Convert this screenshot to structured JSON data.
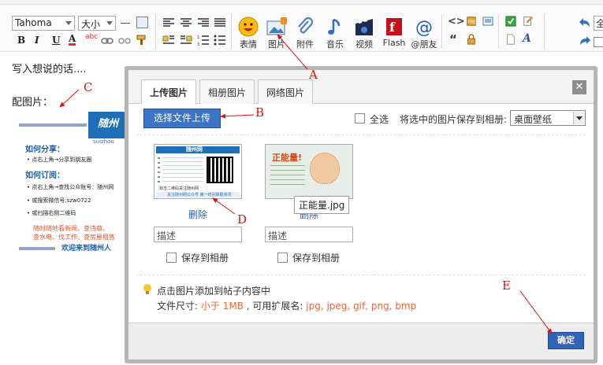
{
  "toolbar": {
    "font_name": "Tahoma",
    "font_size": "大小",
    "format_buttons": [
      "B",
      "I",
      "U",
      "A"
    ],
    "media_tools": [
      {
        "label": "表情",
        "icon": "smiley-icon"
      },
      {
        "label": "图片",
        "icon": "image-icon"
      },
      {
        "label": "附件",
        "icon": "paperclip-icon"
      },
      {
        "label": "音乐",
        "icon": "music-note-icon"
      },
      {
        "label": "视频",
        "icon": "video-icon"
      },
      {
        "label": "Flash",
        "icon": "flash-icon"
      },
      {
        "label": "@朋友",
        "icon": "at-icon"
      }
    ],
    "right_partial_text": "全"
  },
  "editor": {
    "placeholder_text": "写入想说的话....",
    "image_label": "配图片：",
    "preview": {
      "brand": "随州",
      "brand_sub": "suizhou",
      "heading1": "如何分享：",
      "line1": "点右上角→分享到朋友圈",
      "heading2": "如何订阅：",
      "line2": "点右上角→查找公众账号：随州网",
      "line3": "或搜索微信号:szw0722",
      "line4": "或扫描右侧二维码",
      "promo1": "随时随地看新闻、查违章、",
      "promo2": "查水电、找工作、查房屋租售",
      "footer": "欢迎来到随州人"
    }
  },
  "dialog": {
    "tabs": [
      "上传图片",
      "相册图片",
      "网络图片"
    ],
    "active_tab": 0,
    "close_label": "✕",
    "upload_button": "选择文件上传",
    "select_all_label": "全选",
    "save_to_album_label": "将选中的图片保存到相册:",
    "album_selected": "桌面壁纸",
    "images": [
      {
        "delete_label": "删除",
        "desc_placeholder": "描述",
        "save_label": "保存到相册",
        "thumb_title": "随州网",
        "thumb_text": "双击二维码关注随州网",
        "thumb_footer": "关注随州网公众号 第一时间获取资讯"
      },
      {
        "delete_label": "删除",
        "desc_placeholder": "描述",
        "save_label": "保存到相册",
        "thumb_title": "正能量!",
        "filename_tooltip": "正能量.jpg"
      }
    ],
    "hint": "点击图片添加到帖子内容中",
    "size_label": "文件尺寸:",
    "size_value": "小于 1MB",
    "ext_label": ", 可用扩展名:",
    "ext_value": "jpg, jpeg, gif, png, bmp",
    "ok_button": "确定"
  },
  "annotations": [
    "A",
    "B",
    "C",
    "D",
    "E"
  ],
  "colors": {
    "accent": "#3b74c5",
    "annotation": "#dd1111",
    "link": "#2a62b3",
    "size_highlight": "#e8663a"
  }
}
